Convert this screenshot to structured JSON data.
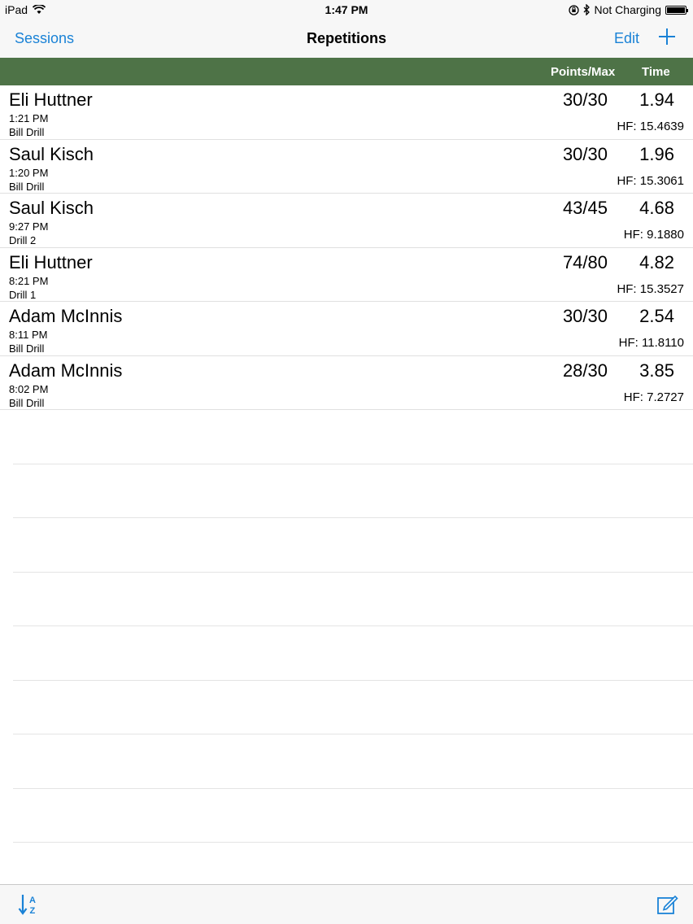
{
  "status_bar": {
    "device": "iPad",
    "time": "1:47 PM",
    "charging": "Not Charging",
    "battery_fraction": 1.0
  },
  "nav": {
    "back_label": "Sessions",
    "title": "Repetitions",
    "edit_label": "Edit",
    "add_icon": "plus-icon"
  },
  "header": {
    "points_label": "Points/Max",
    "time_label": "Time"
  },
  "rows": [
    {
      "name": "Eli Huttner",
      "time": "1:21 PM",
      "drill": "Bill Drill",
      "points": "30/30",
      "score_time": "1.94",
      "hf": "HF: 15.4639"
    },
    {
      "name": "Saul Kisch",
      "time": "1:20 PM",
      "drill": "Bill Drill",
      "points": "30/30",
      "score_time": "1.96",
      "hf": "HF: 15.3061"
    },
    {
      "name": "Saul Kisch",
      "time": "9:27 PM",
      "drill": "Drill 2",
      "points": "43/45",
      "score_time": "4.68",
      "hf": "HF: 9.1880"
    },
    {
      "name": "Eli Huttner",
      "time": "8:21 PM",
      "drill": "Drill 1",
      "points": "74/80",
      "score_time": "4.82",
      "hf": "HF: 15.3527"
    },
    {
      "name": "Adam McInnis",
      "time": "8:11 PM",
      "drill": "Bill Drill",
      "points": "30/30",
      "score_time": "2.54",
      "hf": "HF: 11.8110"
    },
    {
      "name": "Adam McInnis",
      "time": "8:02 PM",
      "drill": "Bill Drill",
      "points": "28/30",
      "score_time": "3.85",
      "hf": "HF: 7.2727"
    }
  ],
  "toolbar": {
    "sort_icon": "sort-az-icon",
    "compose_icon": "compose-icon"
  },
  "colors": {
    "accent": "#1a82d6",
    "header_bg": "#4e7347"
  }
}
